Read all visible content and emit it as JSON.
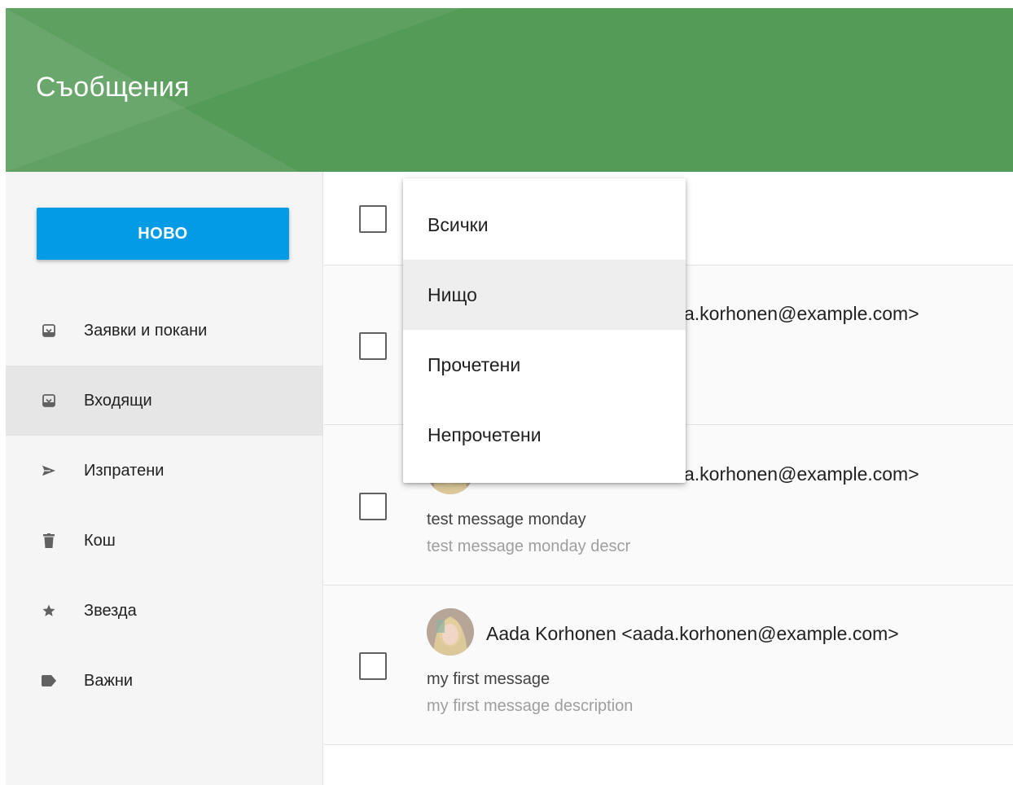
{
  "header": {
    "title": "Съобщения"
  },
  "sidebar": {
    "new_button_label": "НОВО",
    "items": [
      {
        "label": "Заявки и покани",
        "icon": "inbox-icon",
        "active": false
      },
      {
        "label": "Входящи",
        "icon": "inbox-icon",
        "active": true
      },
      {
        "label": "Изпратени",
        "icon": "send-icon",
        "active": false
      },
      {
        "label": "Кош",
        "icon": "trash-icon",
        "active": false
      },
      {
        "label": "Звезда",
        "icon": "star-icon",
        "active": false
      },
      {
        "label": "Важни",
        "icon": "label-icon",
        "active": false
      }
    ]
  },
  "filter_menu": {
    "items": [
      {
        "label": "Всички"
      },
      {
        "label": "Нищо",
        "hovered": true
      },
      {
        "label": "Прочетени"
      },
      {
        "label": "Непрочетени"
      }
    ]
  },
  "messages": [
    {
      "sender_visible": "a.korhonen@example.com>",
      "subject": "",
      "preview": ""
    },
    {
      "sender_visible": "a.korhonen@example.com>",
      "subject": "test message monday",
      "preview": "test message monday descr"
    },
    {
      "sender_visible": "Aada Korhonen <aada.korhonen@example.com>",
      "subject": "my first message",
      "preview": "my first message description"
    }
  ],
  "colors": {
    "header_bg": "#549b57",
    "accent_button": "#039be5",
    "sidebar_bg": "#f5f5f5",
    "active_item_bg": "#e6e6e6"
  }
}
